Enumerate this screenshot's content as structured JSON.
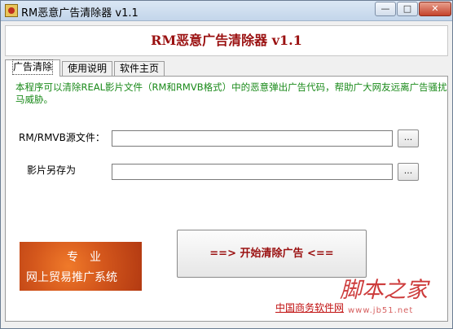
{
  "window": {
    "title": "RM恶意广告清除器 v1.1",
    "min_icon": "minimize-icon",
    "max_icon": "maximize-icon",
    "close_icon": "close-icon"
  },
  "header": {
    "title": "RM恶意广告清除器 v1.1"
  },
  "tabs": [
    {
      "label": "广告清除",
      "active": true
    },
    {
      "label": "使用说明",
      "active": false
    },
    {
      "label": "软件主页",
      "active": false
    }
  ],
  "main": {
    "description": "本程序可以清除REAL影片文件（RM和RMVB格式）中的恶意弹出广告代码，帮助广大网友远离广告骚扰及木马威胁。",
    "source_label": "RM/RMVB源文件：",
    "source_value": "",
    "saveas_label": "影片另存为",
    "saveas_value": "",
    "browse_label": "...",
    "banner_line1": "专　业",
    "banner_line2": "网上贸易推广系统",
    "start_button": "==>  开始清除广告  <==",
    "footer_link": "中国商务软件网"
  },
  "watermark": {
    "text": "脚本之家",
    "url": "www.jb51.net"
  },
  "colors": {
    "title_red": "#9a1010",
    "desc_green": "#1a8a1a",
    "link_red": "#c01010",
    "banner_orange": "#d4571c"
  }
}
